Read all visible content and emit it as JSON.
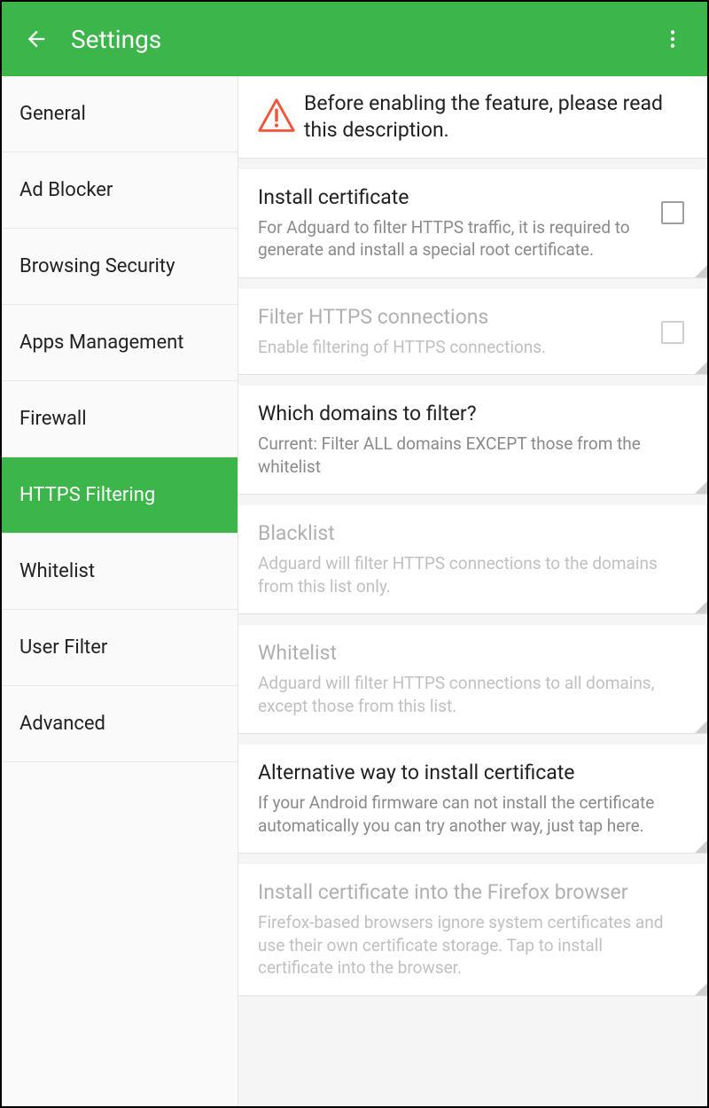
{
  "appbar": {
    "title": "Settings"
  },
  "sidebar": {
    "items": [
      {
        "label": "General"
      },
      {
        "label": "Ad Blocker"
      },
      {
        "label": "Browsing Security"
      },
      {
        "label": "Apps Management"
      },
      {
        "label": "Firewall"
      },
      {
        "label": "HTTPS Filtering"
      },
      {
        "label": "Whitelist"
      },
      {
        "label": "User Filter"
      },
      {
        "label": "Advanced"
      }
    ],
    "active_index": 5
  },
  "warning": {
    "text": "Before enabling the feature, please read this description."
  },
  "settings": [
    {
      "title": "Install certificate",
      "desc": "For Adguard to filter HTTPS traffic, it is required to generate and install a special root certificate.",
      "checkbox": true,
      "checked": false,
      "disabled": false
    },
    {
      "title": "Filter HTTPS connections",
      "desc": "Enable filtering of HTTPS connections.",
      "checkbox": true,
      "checked": false,
      "disabled": true
    },
    {
      "title": "Which domains to filter?",
      "desc": "Current: Filter ALL domains EXCEPT those from the whitelist",
      "checkbox": false,
      "disabled": false
    },
    {
      "title": "Blacklist",
      "desc": "Adguard will filter HTTPS connections to the domains from this list only.",
      "checkbox": false,
      "disabled": true
    },
    {
      "title": "Whitelist",
      "desc": "Adguard will filter HTTPS connections to all domains, except those from this list.",
      "checkbox": false,
      "disabled": true
    },
    {
      "title": "Alternative way to install certificate",
      "desc": "If your Android firmware can not install the certificate automatically you can try another way, just tap here.",
      "checkbox": false,
      "disabled": false
    },
    {
      "title": "Install certificate into the Firefox browser",
      "desc": "Firefox-based browsers ignore system certificates and use their own certificate storage. Tap to install certificate into the browser.",
      "checkbox": false,
      "disabled": true
    }
  ]
}
